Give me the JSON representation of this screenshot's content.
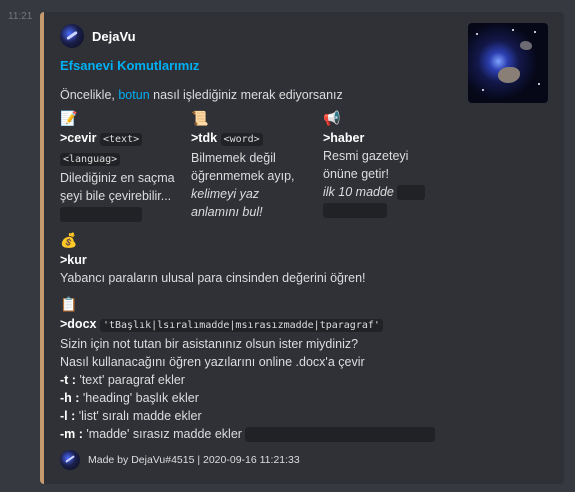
{
  "message": {
    "timestamp": "11:21"
  },
  "embed": {
    "accent_color": "#c69a6c",
    "author": {
      "name": "DejaVu"
    },
    "title": "Efsanevi Komutlarımız",
    "description": {
      "before": "Öncelikle, ",
      "link": "botun",
      "after": " nasıl işlediğiniz merak ediyorsanız"
    },
    "fields": {
      "cevir": {
        "emoji_icon": "memo-icon",
        "emoji": "📝",
        "name": ">cevir",
        "code1": "<text>",
        "code2": "<languag>",
        "lines": [
          "Dilediğiniz en saçma",
          "şeyi bile çevirebilir..."
        ]
      },
      "tdk": {
        "emoji_icon": "scroll-icon",
        "emoji": "📜",
        "name": ">tdk",
        "code1": "<word>",
        "lines": [
          "Bilmemek değil",
          "öğrenmemek ayıp,"
        ],
        "italic_lines": [
          "kelimeyi yaz",
          "anlamını bul!"
        ]
      },
      "haber": {
        "emoji_icon": "loudspeaker-icon",
        "emoji": "📢",
        "name": ">haber",
        "lines": [
          "Resmi gazeteyi",
          "önüne getir!"
        ],
        "italic_line": "ilk 10 madde"
      },
      "kur": {
        "emoji_icon": "money-bag-icon",
        "emoji": "💰",
        "name": ">kur",
        "line": "Yabancı paraların ulusal para cinsinden değerini öğren!"
      },
      "docx": {
        "emoji_icon": "clipboard-icon",
        "emoji": "📋",
        "name": ">docx",
        "code": "'tBaşlık|lsıralımadde|msırasızmadde|tparagraf'",
        "lines": [
          "Sizin için not tutan bir asistanınız olsun ister miydiniz?",
          "Nasıl kullanacağını öğren yazılarını online .docx'a çevir"
        ],
        "options": [
          {
            "flag": "-t :",
            "text": " 'text' paragraf ekler"
          },
          {
            "flag": "-h :",
            "text": " 'heading' başlık ekler"
          },
          {
            "flag": "-l :",
            "text": " 'list' sıralı madde ekler"
          },
          {
            "flag": "-m :",
            "text": " 'madde' sırasız madde ekler"
          }
        ]
      }
    },
    "footer": {
      "text": "Made by DejaVu#4515 | 2020-09-16 11:21:33"
    }
  }
}
